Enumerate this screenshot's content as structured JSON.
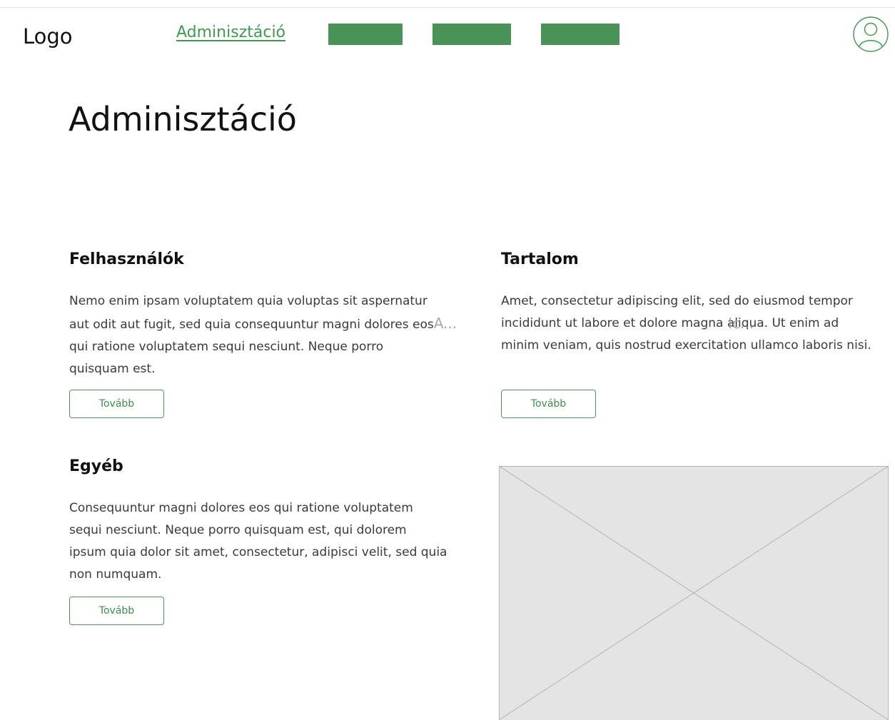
{
  "header": {
    "logo": "Logo",
    "active_nav": "Adminisztáció"
  },
  "page": {
    "title": "Adminisztáció"
  },
  "cards": [
    {
      "title": "Felhasználók",
      "lines": [
        "Nemo enim ipsam voluptatem quia voluptas sit aspernatur",
        "aut odit aut fugit, sed quia consequuntur magni dolores eos",
        "qui ratione voluptatem sequi nesciunt. Neque porro",
        "quisquam est."
      ],
      "overflow_mark": "A...",
      "button": "Tovább"
    },
    {
      "title": "Tartalom",
      "lines": [
        "Amet, consectetur adipiscing elit, sed do eiusmod tempor",
        "incididunt ut labore et dolore magna aliqua. Ut enim ad",
        "minim veniam, quis nostrud exercitation ullamco laboris nisi."
      ],
      "overflow_mark": "Ic...",
      "button": "Tovább"
    },
    {
      "title": "Egyéb",
      "lines": [
        "Consequuntur magni dolores eos qui ratione voluptatem",
        "sequi nesciunt. Neque porro quisquam est, qui dolorem",
        "ipsum quia dolor sit amet, consectetur, adipisci velit, sed quia",
        "non numquam."
      ],
      "button": "Tovább"
    }
  ],
  "icons": {
    "avatar": "user-avatar-icon",
    "image": "image-placeholder"
  },
  "colors": {
    "accent": "#3e9a4c",
    "nav_block": "#4a9357",
    "placeholder_fill": "#e4e4e4",
    "placeholder_stroke": "#b4b4b4"
  }
}
